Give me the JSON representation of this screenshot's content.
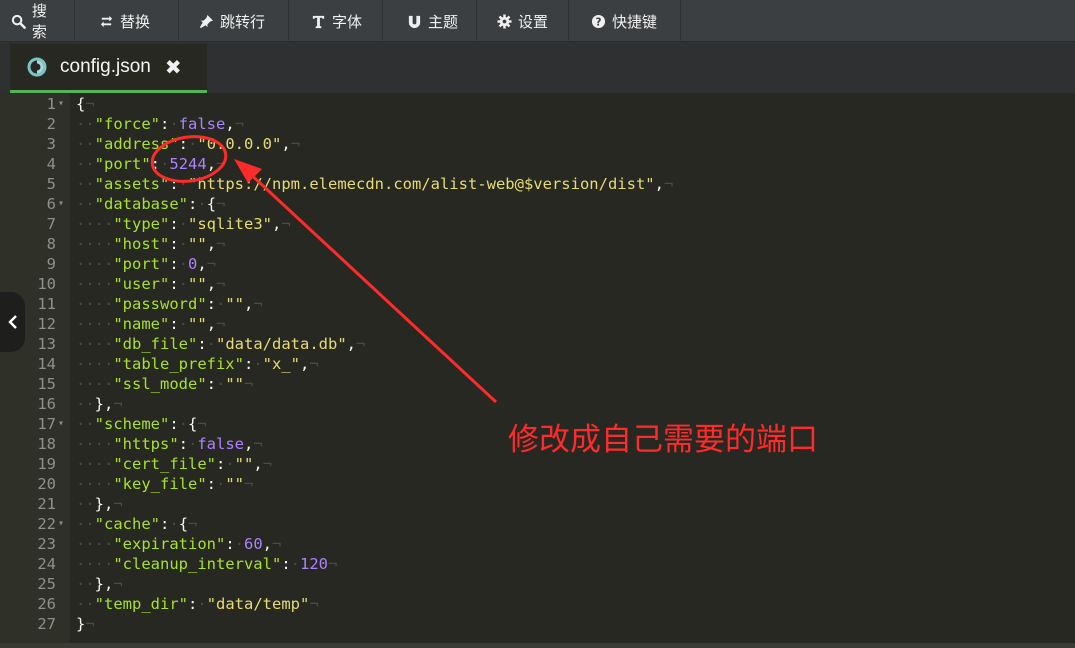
{
  "toolbar": {
    "buttons": [
      {
        "label": "搜索",
        "icon": "search-icon"
      },
      {
        "label": "替换",
        "icon": "replace-icon"
      },
      {
        "label": "跳转行",
        "icon": "pin-icon"
      },
      {
        "label": "字体",
        "icon": "text-icon"
      },
      {
        "label": "主题",
        "icon": "magnet-icon"
      },
      {
        "label": "设置",
        "icon": "gear-icon"
      },
      {
        "label": "快捷键",
        "icon": "help-icon"
      }
    ]
  },
  "tab": {
    "title": "config.json",
    "icon": "file-icon",
    "close_icon": "close-icon"
  },
  "editor": {
    "lines": [
      {
        "n": "1",
        "fold": true,
        "text": "{"
      },
      {
        "n": "2",
        "fold": false,
        "text": "  \"force\": false,"
      },
      {
        "n": "3",
        "fold": false,
        "text": "  \"address\": \"0.0.0.0\","
      },
      {
        "n": "4",
        "fold": false,
        "text": "  \"port\": 5244,"
      },
      {
        "n": "5",
        "fold": false,
        "text": "  \"assets\": \"https://npm.elemecdn.com/alist-web@$version/dist\","
      },
      {
        "n": "6",
        "fold": true,
        "text": "  \"database\": {"
      },
      {
        "n": "7",
        "fold": false,
        "text": "    \"type\": \"sqlite3\","
      },
      {
        "n": "8",
        "fold": false,
        "text": "    \"host\": \"\","
      },
      {
        "n": "9",
        "fold": false,
        "text": "    \"port\": 0,"
      },
      {
        "n": "10",
        "fold": false,
        "text": "    \"user\": \"\","
      },
      {
        "n": "11",
        "fold": false,
        "text": "    \"password\": \"\","
      },
      {
        "n": "12",
        "fold": false,
        "text": "    \"name\": \"\","
      },
      {
        "n": "13",
        "fold": false,
        "text": "    \"db_file\": \"data/data.db\","
      },
      {
        "n": "14",
        "fold": false,
        "text": "    \"table_prefix\": \"x_\","
      },
      {
        "n": "15",
        "fold": false,
        "text": "    \"ssl_mode\": \"\""
      },
      {
        "n": "16",
        "fold": false,
        "text": "  },"
      },
      {
        "n": "17",
        "fold": true,
        "text": "  \"scheme\": {"
      },
      {
        "n": "18",
        "fold": false,
        "text": "    \"https\": false,"
      },
      {
        "n": "19",
        "fold": false,
        "text": "    \"cert_file\": \"\","
      },
      {
        "n": "20",
        "fold": false,
        "text": "    \"key_file\": \"\""
      },
      {
        "n": "21",
        "fold": false,
        "text": "  },"
      },
      {
        "n": "22",
        "fold": true,
        "text": "  \"cache\": {"
      },
      {
        "n": "23",
        "fold": false,
        "text": "    \"expiration\": 60,"
      },
      {
        "n": "24",
        "fold": false,
        "text": "    \"cleanup_interval\": 120"
      },
      {
        "n": "25",
        "fold": false,
        "text": "  },"
      },
      {
        "n": "26",
        "fold": false,
        "text": "  \"temp_dir\": \"data/temp\""
      },
      {
        "n": "27",
        "fold": false,
        "text": "}"
      }
    ]
  },
  "annotation": {
    "text": "修改成自己需要的端口",
    "color": "#ff2a2a"
  },
  "colors": {
    "background": "#272822",
    "key": "#a6e22e",
    "string": "#e6db74",
    "number": "#ae81ff",
    "tab_accent": "#56b25a"
  }
}
